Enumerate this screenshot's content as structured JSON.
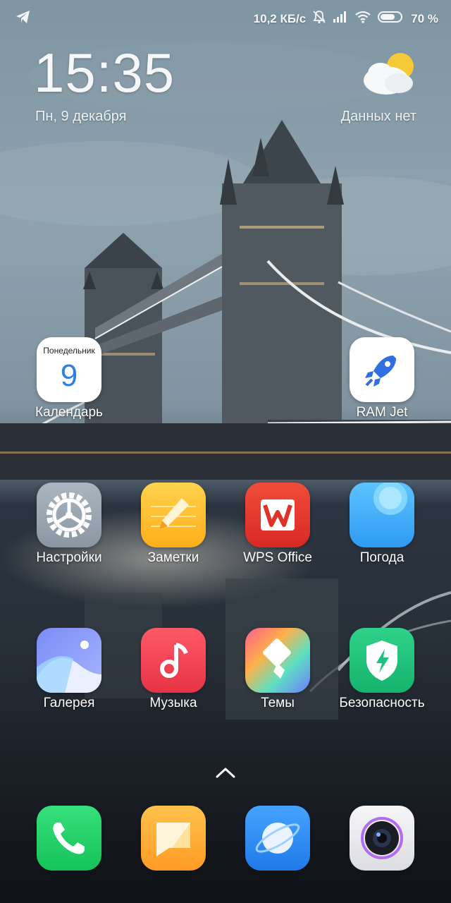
{
  "status_bar": {
    "speed": "10,2 КБ/с",
    "battery": "70 %",
    "icons": [
      "telegram-icon",
      "dnd-bell-off-icon",
      "signal-icon",
      "wifi-icon",
      "battery-icon"
    ]
  },
  "clock": {
    "time": "15:35",
    "date": "Пн, 9 декабря"
  },
  "weather": {
    "icon": "partly-cloudy-icon",
    "text": "Данных нет"
  },
  "apps": [
    {
      "label": "Календарь",
      "icon": "calendar-icon",
      "calendar_day_name": "Понедельник",
      "calendar_day_number": "9"
    },
    {
      "label": "RAM Jet",
      "icon": "rocket-icon"
    },
    {
      "label": "Настройки",
      "icon": "gear-icon"
    },
    {
      "label": "Заметки",
      "icon": "pencil-icon"
    },
    {
      "label": "WPS Office",
      "icon": "wps-icon"
    },
    {
      "label": "Погода",
      "icon": "weather-app-icon"
    },
    {
      "label": "Галерея",
      "icon": "gallery-icon"
    },
    {
      "label": "Музыка",
      "icon": "music-note-icon"
    },
    {
      "label": "Темы",
      "icon": "themes-brush-icon"
    },
    {
      "label": "Безопасность",
      "icon": "shield-bolt-icon"
    }
  ],
  "dock": [
    {
      "icon": "phone-icon"
    },
    {
      "icon": "messages-icon"
    },
    {
      "icon": "browser-icon"
    },
    {
      "icon": "camera-icon"
    }
  ],
  "colors": {
    "phone": "#22d26a",
    "messages": "#ffb23a",
    "browser": "#2f8cf4",
    "notes": "#ffbf2a",
    "wps": "#e5332a",
    "music": "#f0404f",
    "security": "#1fc27c"
  }
}
